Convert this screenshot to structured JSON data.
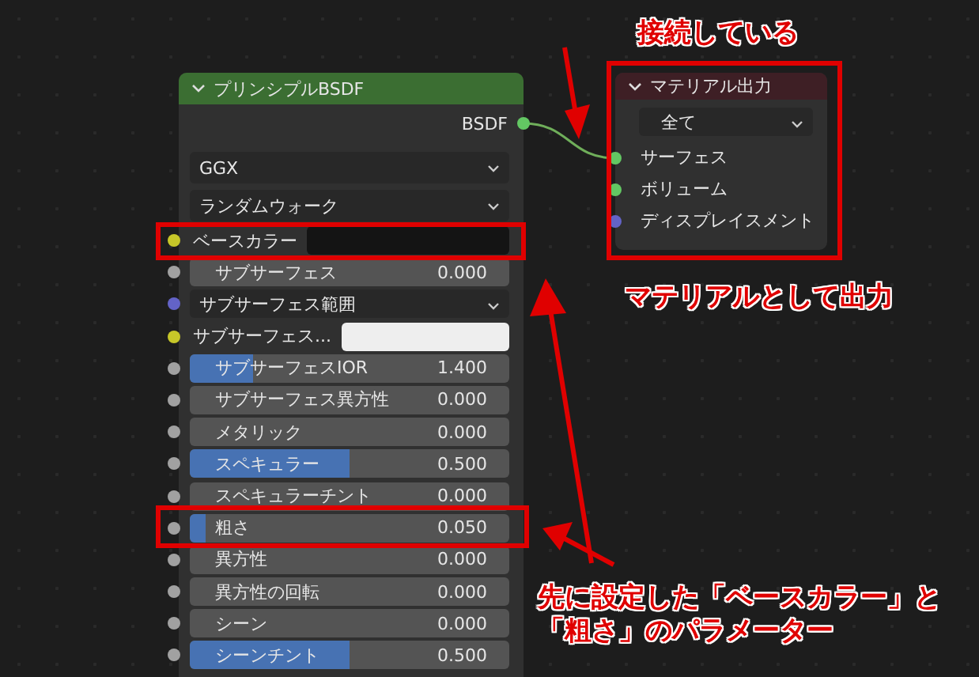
{
  "principled_node": {
    "title": "プリンシプルBSDF",
    "collapsed": false,
    "output": "BSDF",
    "dropdowns": [
      "GGX",
      "ランダムウォーク"
    ],
    "inputs": [
      {
        "kind": "color",
        "label": "ベースカラー",
        "color": "#c7c729",
        "swatch": {
          "color": "#141414"
        }
      },
      {
        "kind": "slider",
        "label": "サブサーフェス",
        "value": "0.000",
        "color": "#a1a1a1"
      },
      {
        "kind": "dropdown",
        "label": "サブサーフェス範囲",
        "color": "#6363c7"
      },
      {
        "kind": "color",
        "label": "サブサーフェス...",
        "color": "#c7c729",
        "swatch": {
          "color": "#eeeeee"
        }
      },
      {
        "kind": "slider",
        "label": "サブサーフェスIOR",
        "value": "1.400",
        "level": 0.2,
        "color": "#a1a1a1"
      },
      {
        "kind": "slider",
        "label": "サブサーフェス異方性",
        "value": "0.000",
        "color": "#a1a1a1"
      },
      {
        "kind": "slider",
        "label": "メタリック",
        "value": "0.000",
        "color": "#a1a1a1"
      },
      {
        "kind": "slider",
        "label": "スペキュラー",
        "value": "0.500",
        "level": 0.5,
        "color": "#a1a1a1"
      },
      {
        "kind": "slider",
        "label": "スペキュラーチント",
        "value": "0.000",
        "color": "#a1a1a1"
      },
      {
        "kind": "slider",
        "label": "粗さ",
        "value": "0.050",
        "level": 0.05,
        "color": "#a1a1a1"
      },
      {
        "kind": "slider",
        "label": "異方性",
        "value": "0.000",
        "color": "#a1a1a1"
      },
      {
        "kind": "slider",
        "label": "異方性の回転",
        "value": "0.000",
        "color": "#a1a1a1"
      },
      {
        "kind": "slider",
        "label": "シーン",
        "value": "0.000",
        "color": "#a1a1a1"
      },
      {
        "kind": "slider",
        "label": "シーンチント",
        "value": "0.500",
        "level": 0.5,
        "color": "#a1a1a1"
      }
    ]
  },
  "output_node": {
    "title": "マテリアル出力",
    "collapsed": false,
    "target": "全て",
    "inputs": [
      {
        "label": "サーフェス",
        "color": "#63c763"
      },
      {
        "label": "ボリューム",
        "color": "#63c763"
      },
      {
        "label": "ディスプレイスメント",
        "color": "#6363c7"
      }
    ]
  },
  "annotations": {
    "connected": "接続している",
    "output": "マテリアルとして出力",
    "params": [
      "先に設定した「ベースカラー」と",
      "「粗さ」のパラメーター"
    ]
  }
}
